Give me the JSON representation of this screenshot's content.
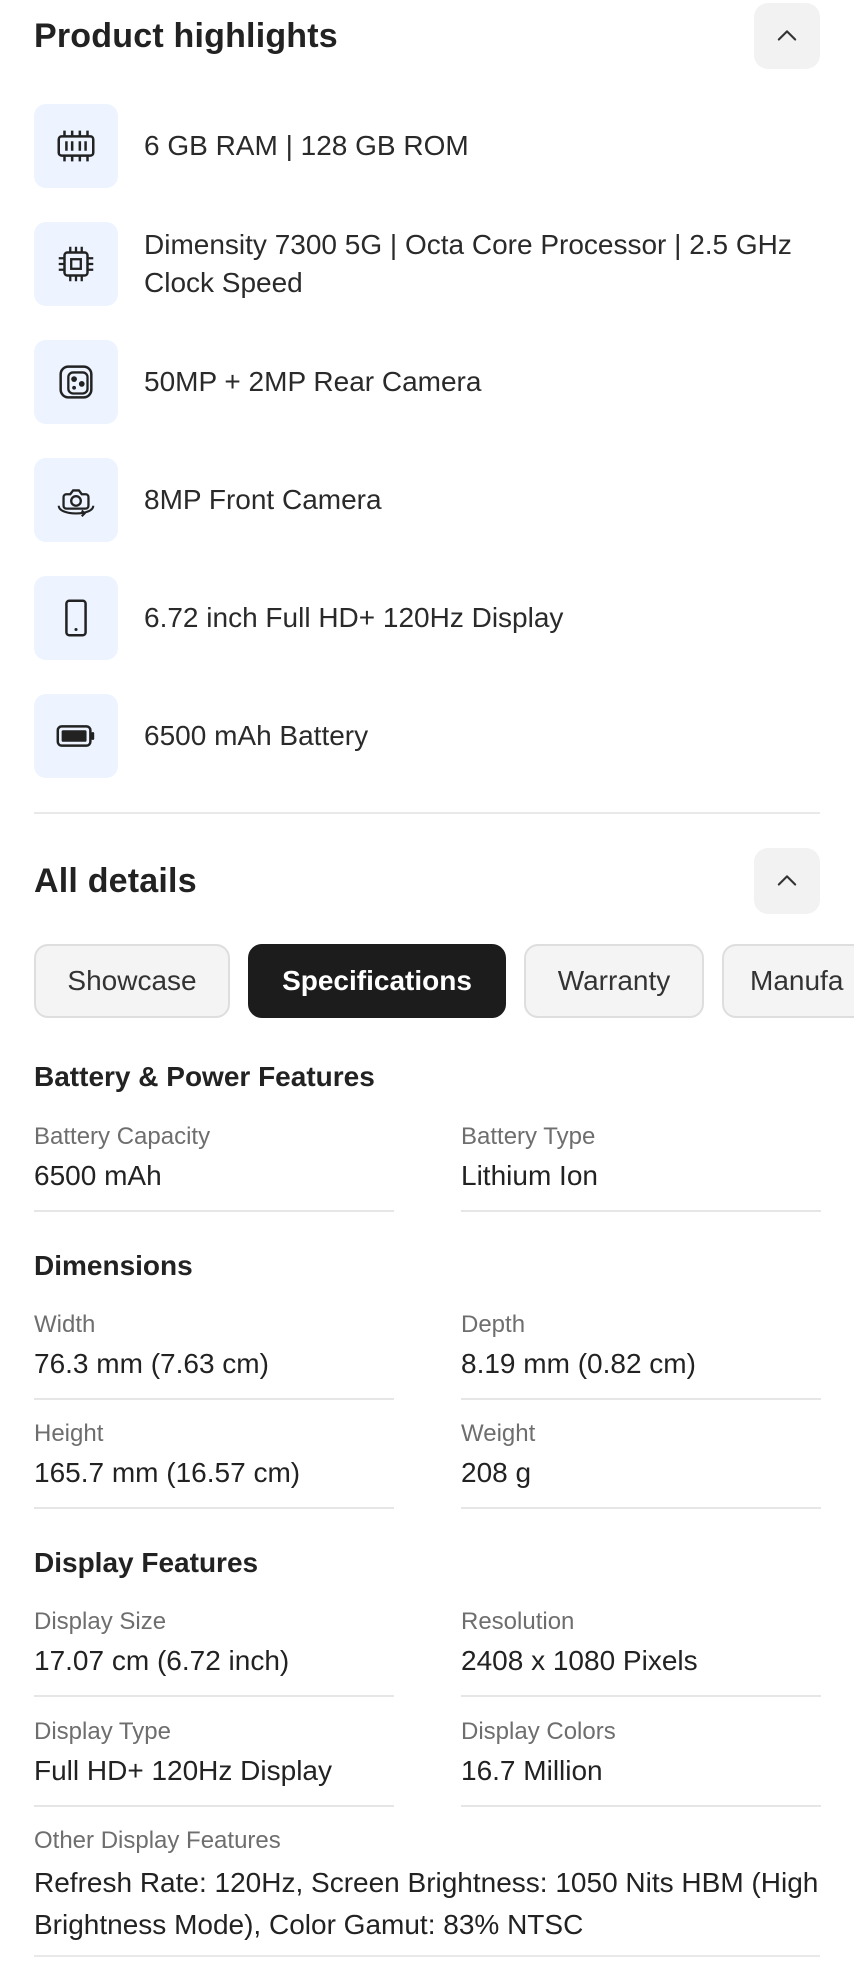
{
  "highlights": {
    "title": "Product highlights",
    "items": [
      {
        "icon": "memory-icon",
        "text": "6 GB RAM | 128 GB ROM"
      },
      {
        "icon": "processor-icon",
        "text": "Dimensity 7300 5G | Octa Core Processor | 2.5 GHz Clock Speed"
      },
      {
        "icon": "rear-camera-icon",
        "text": "50MP + 2MP Rear Camera"
      },
      {
        "icon": "front-camera-icon",
        "text": "8MP Front Camera"
      },
      {
        "icon": "display-icon",
        "text": "6.72 inch Full HD+ 120Hz Display"
      },
      {
        "icon": "battery-icon",
        "text": "6500 mAh Battery"
      }
    ]
  },
  "details": {
    "title": "All details",
    "tabs": [
      {
        "label": "Showcase",
        "active": false
      },
      {
        "label": "Specifications",
        "active": true
      },
      {
        "label": "Warranty",
        "active": false
      },
      {
        "label": "Manufa",
        "active": false
      }
    ]
  },
  "specs": {
    "battery": {
      "title": "Battery & Power Features",
      "capacity_label": "Battery Capacity",
      "capacity_value": "6500 mAh",
      "type_label": "Battery Type",
      "type_value": "Lithium Ion"
    },
    "dimensions": {
      "title": "Dimensions",
      "width_label": "Width",
      "width_value": "76.3 mm (7.63 cm)",
      "depth_label": "Depth",
      "depth_value": "8.19 mm (0.82 cm)",
      "height_label": "Height",
      "height_value": "165.7 mm (16.57 cm)",
      "weight_label": "Weight",
      "weight_value": "208 g"
    },
    "display": {
      "title": "Display Features",
      "size_label": "Display Size",
      "size_value": "17.07 cm (6.72 inch)",
      "resolution_label": "Resolution",
      "resolution_value": "2408 x 1080 Pixels",
      "type_label": "Display Type",
      "type_value": "Full HD+ 120Hz Display",
      "colors_label": "Display Colors",
      "colors_value": "16.7 Million",
      "other_label": "Other Display Features",
      "other_value": "Refresh Rate: 120Hz, Screen Brightness: 1050 Nits HBM (High Brightness Mode), Color Gamut: 83% NTSC"
    }
  }
}
